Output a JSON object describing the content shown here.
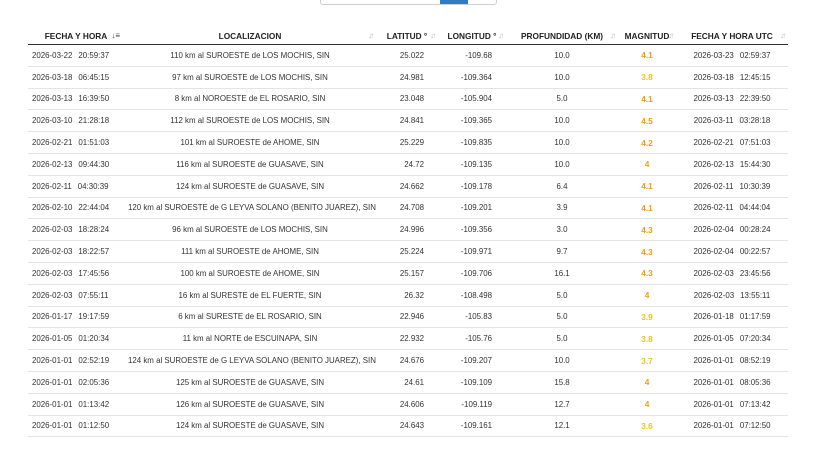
{
  "colors": {
    "mag_orange": "#f39c12",
    "mag_yellow": "#f1c40f",
    "accent": "#2f7dc0"
  },
  "headers": {
    "fecha": "FECHA Y HORA",
    "loc": "LOCALIZACION",
    "lat": "LATITUD °",
    "lon": "LONGITUD °",
    "prof": "PROFUNDIDAD (KM)",
    "mag": "MAGNITUD",
    "utc": "FECHA Y HORA UTC"
  },
  "rows": [
    {
      "date": "2026-03-22",
      "time": "20:59:37",
      "loc": "110 km al SUROESTE de LOS MOCHIS, SIN",
      "lat": "25.022",
      "lon": "-109.68",
      "depth": "10.0",
      "mag": "4.1",
      "mag_level": "orange",
      "utc_date": "2026-03-23",
      "utc_time": "02:59:37"
    },
    {
      "date": "2026-03-18",
      "time": "06:45:15",
      "loc": "97 km al SUROESTE de LOS MOCHIS, SIN",
      "lat": "24.981",
      "lon": "-109.364",
      "depth": "10.0",
      "mag": "3.8",
      "mag_level": "yellow",
      "utc_date": "2026-03-18",
      "utc_time": "12:45:15"
    },
    {
      "date": "2026-03-13",
      "time": "16:39:50",
      "loc": "8 km al NOROESTE de EL ROSARIO, SIN",
      "lat": "23.048",
      "lon": "-105.904",
      "depth": "5.0",
      "mag": "4.1",
      "mag_level": "orange",
      "utc_date": "2026-03-13",
      "utc_time": "22:39:50"
    },
    {
      "date": "2026-03-10",
      "time": "21:28:18",
      "loc": "112 km al SUROESTE de LOS MOCHIS, SIN",
      "lat": "24.841",
      "lon": "-109.365",
      "depth": "10.0",
      "mag": "4.5",
      "mag_level": "orange",
      "utc_date": "2026-03-11",
      "utc_time": "03:28:18"
    },
    {
      "date": "2026-02-21",
      "time": "01:51:03",
      "loc": "101 km al SUROESTE de AHOME, SIN",
      "lat": "25.229",
      "lon": "-109.835",
      "depth": "10.0",
      "mag": "4.2",
      "mag_level": "orange",
      "utc_date": "2026-02-21",
      "utc_time": "07:51:03"
    },
    {
      "date": "2026-02-13",
      "time": "09:44:30",
      "loc": "116 km al SUROESTE de GUASAVE, SIN",
      "lat": "24.72",
      "lon": "-109.135",
      "depth": "10.0",
      "mag": "4",
      "mag_level": "orange",
      "utc_date": "2026-02-13",
      "utc_time": "15:44:30"
    },
    {
      "date": "2026-02-11",
      "time": "04:30:39",
      "loc": "124 km al SUROESTE de GUASAVE, SIN",
      "lat": "24.662",
      "lon": "-109.178",
      "depth": "6.4",
      "mag": "4.1",
      "mag_level": "orange",
      "utc_date": "2026-02-11",
      "utc_time": "10:30:39"
    },
    {
      "date": "2026-02-10",
      "time": "22:44:04",
      "loc": "120 km al SUROESTE de G LEYVA SOLANO (BENITO JUAREZ), SIN",
      "lat": "24.708",
      "lon": "-109.201",
      "depth": "3.9",
      "mag": "4.1",
      "mag_level": "orange",
      "utc_date": "2026-02-11",
      "utc_time": "04:44:04"
    },
    {
      "date": "2026-02-03",
      "time": "18:28:24",
      "loc": "96 km al SUROESTE de LOS MOCHIS, SIN",
      "lat": "24.996",
      "lon": "-109.356",
      "depth": "3.0",
      "mag": "4.3",
      "mag_level": "orange",
      "utc_date": "2026-02-04",
      "utc_time": "00:28:24"
    },
    {
      "date": "2026-02-03",
      "time": "18:22:57",
      "loc": "111 km al SUROESTE de AHOME, SIN",
      "lat": "25.224",
      "lon": "-109.971",
      "depth": "9.7",
      "mag": "4.3",
      "mag_level": "orange",
      "utc_date": "2026-02-04",
      "utc_time": "00:22:57"
    },
    {
      "date": "2026-02-03",
      "time": "17:45:56",
      "loc": "100 km al SUROESTE de AHOME, SIN",
      "lat": "25.157",
      "lon": "-109.706",
      "depth": "16.1",
      "mag": "4.3",
      "mag_level": "orange",
      "utc_date": "2026-02-03",
      "utc_time": "23:45:56"
    },
    {
      "date": "2026-02-03",
      "time": "07:55:11",
      "loc": "16 km al SURESTE de EL FUERTE, SIN",
      "lat": "26.32",
      "lon": "-108.498",
      "depth": "5.0",
      "mag": "4",
      "mag_level": "orange",
      "utc_date": "2026-02-03",
      "utc_time": "13:55:11"
    },
    {
      "date": "2026-01-17",
      "time": "19:17:59",
      "loc": "6 km al SURESTE de EL ROSARIO, SIN",
      "lat": "22.946",
      "lon": "-105.83",
      "depth": "5.0",
      "mag": "3.9",
      "mag_level": "yellow",
      "utc_date": "2026-01-18",
      "utc_time": "01:17:59"
    },
    {
      "date": "2026-01-05",
      "time": "01:20:34",
      "loc": "11 km al NORTE de ESCUINAPA, SIN",
      "lat": "22.932",
      "lon": "-105.76",
      "depth": "5.0",
      "mag": "3.8",
      "mag_level": "yellow",
      "utc_date": "2026-01-05",
      "utc_time": "07:20:34"
    },
    {
      "date": "2026-01-01",
      "time": "02:52:19",
      "loc": "124 km al SUROESTE de G LEYVA SOLANO (BENITO JUAREZ), SIN",
      "lat": "24.676",
      "lon": "-109.207",
      "depth": "10.0",
      "mag": "3.7",
      "mag_level": "yellow",
      "utc_date": "2026-01-01",
      "utc_time": "08:52:19"
    },
    {
      "date": "2026-01-01",
      "time": "02:05:36",
      "loc": "125 km al SUROESTE de GUASAVE, SIN",
      "lat": "24.61",
      "lon": "-109.109",
      "depth": "15.8",
      "mag": "4",
      "mag_level": "orange",
      "utc_date": "2026-01-01",
      "utc_time": "08:05:36"
    },
    {
      "date": "2026-01-01",
      "time": "01:13:42",
      "loc": "126 km al SUROESTE de GUASAVE, SIN",
      "lat": "24.606",
      "lon": "-109.119",
      "depth": "12.7",
      "mag": "4",
      "mag_level": "orange",
      "utc_date": "2026-01-01",
      "utc_time": "07:13:42"
    },
    {
      "date": "2026-01-01",
      "time": "01:12:50",
      "loc": "124 km al SUROESTE de GUASAVE, SIN",
      "lat": "24.643",
      "lon": "-109.161",
      "depth": "12.1",
      "mag": "3.6",
      "mag_level": "yellow",
      "utc_date": "2026-01-01",
      "utc_time": "07:12:50"
    }
  ]
}
